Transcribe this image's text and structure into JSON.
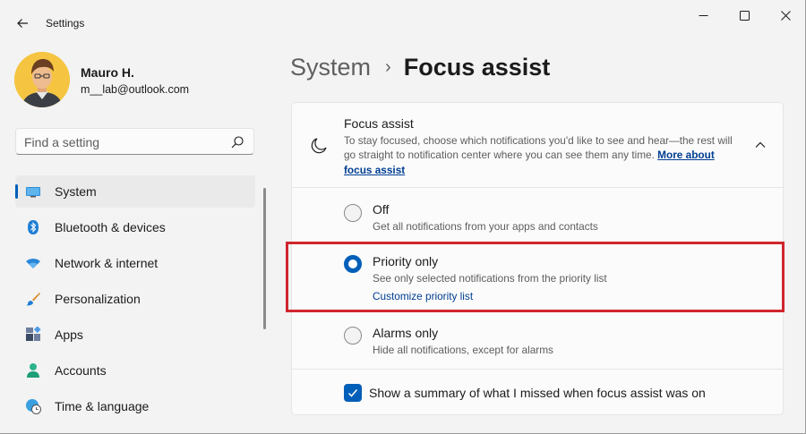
{
  "window": {
    "title": "Settings"
  },
  "profile": {
    "name": "Mauro H.",
    "email": "m__lab@outlook.com"
  },
  "search": {
    "placeholder": "Find a setting"
  },
  "nav": {
    "items": [
      {
        "label": "System",
        "icon": "system-icon",
        "active": true
      },
      {
        "label": "Bluetooth & devices",
        "icon": "bluetooth-icon"
      },
      {
        "label": "Network & internet",
        "icon": "wifi-icon"
      },
      {
        "label": "Personalization",
        "icon": "brush-icon"
      },
      {
        "label": "Apps",
        "icon": "apps-icon"
      },
      {
        "label": "Accounts",
        "icon": "accounts-icon"
      },
      {
        "label": "Time & language",
        "icon": "globe-clock-icon"
      }
    ]
  },
  "breadcrumb": {
    "parent": "System",
    "separator": "›",
    "current": "Focus assist"
  },
  "focus_card": {
    "title": "Focus assist",
    "description": "To stay focused, choose which notifications you'd like to see and hear—the rest will go straight to notification center where you can see them any time.",
    "link": "More about focus assist",
    "expanded": true,
    "options": [
      {
        "label": "Off",
        "description": "Get all notifications from your apps and contacts",
        "selected": false
      },
      {
        "label": "Priority only",
        "description": "See only selected notifications from the priority list",
        "link": "Customize priority list",
        "selected": true
      },
      {
        "label": "Alarms only",
        "description": "Hide all notifications, except for alarms",
        "selected": false
      }
    ],
    "summary_checkbox": {
      "label": "Show a summary of what I missed when focus assist was on",
      "checked": true
    }
  },
  "colors": {
    "accent": "#005fb8",
    "highlight": "#d0262e",
    "background": "#f3f3f3"
  }
}
